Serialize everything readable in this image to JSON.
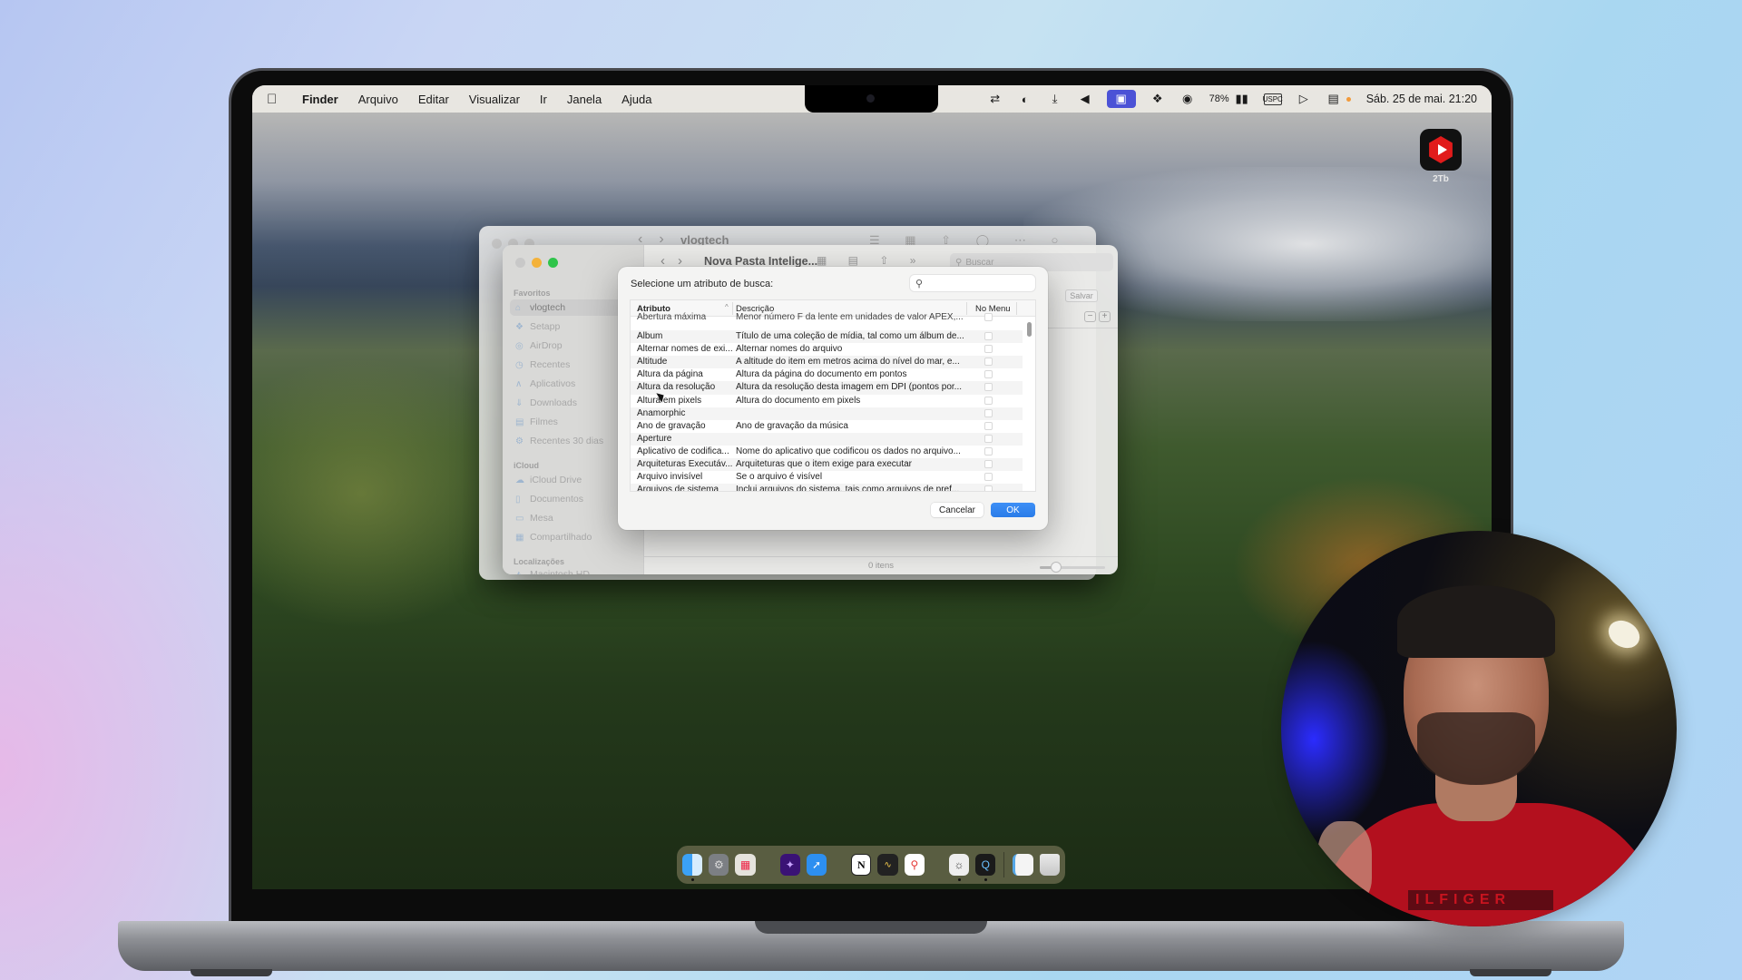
{
  "menubar": {
    "app_name": "Finder",
    "items": [
      "Arquivo",
      "Editar",
      "Visualizar",
      "Ir",
      "Janela",
      "Ajuda"
    ],
    "status_icons": [
      "screen-mirroring-icon",
      "contrast-icon",
      "download-icon",
      "nightshift-icon",
      "screen-sharing-icon",
      "setapp-icon",
      "camera-icon",
      "battery-icon",
      "keyboard-input-icon",
      "play-icon",
      "control-center-icon"
    ],
    "battery_percent": "78%",
    "input_source": "USPC",
    "datetime": "Sáb. 25 de mai.  21:20"
  },
  "desktop": {
    "widget_label": "2Tb"
  },
  "finder_back": {
    "title": "vlogtech"
  },
  "finder_front": {
    "title": "Nova Pasta Intelige...",
    "search_placeholder": "Buscar",
    "save_label": "Salvar",
    "status_text": "0 itens",
    "icon_size_slider": 0.25,
    "sidebar": {
      "sections": [
        {
          "title": "Favoritos",
          "items": [
            {
              "label": "vlogtech",
              "icon": "home-icon",
              "selected": true
            },
            {
              "label": "Setapp",
              "icon": "setapp-icon"
            },
            {
              "label": "AirDrop",
              "icon": "airdrop-icon"
            },
            {
              "label": "Recentes",
              "icon": "clock-icon"
            },
            {
              "label": "Aplicativos",
              "icon": "apps-icon"
            },
            {
              "label": "Downloads",
              "icon": "download-icon"
            },
            {
              "label": "Filmes",
              "icon": "film-icon"
            },
            {
              "label": "Recentes 30 dias",
              "icon": "gear-icon"
            }
          ]
        },
        {
          "title": "iCloud",
          "items": [
            {
              "label": "iCloud Drive",
              "icon": "cloud-icon"
            },
            {
              "label": "Documentos",
              "icon": "document-icon"
            },
            {
              "label": "Mesa",
              "icon": "desktop-icon"
            },
            {
              "label": "Compartilhado",
              "icon": "shared-folder-icon"
            }
          ]
        },
        {
          "title": "Localizações",
          "items": [
            {
              "label": "Macintosh HD",
              "icon": "disk-icon"
            }
          ]
        }
      ]
    }
  },
  "dialog": {
    "title": "Selecione um atributo de busca:",
    "search_value": "",
    "columns": [
      "Atributo",
      "Descrição",
      "No Menu"
    ],
    "rows": [
      {
        "attribute": "Abertura máxima",
        "description": "Menor número F da lente em unidades de valor APEX,...",
        "in_menu": false
      },
      {
        "attribute": "Álbum",
        "description": "Título de uma coleção de mídia, tal como um álbum de...",
        "in_menu": false
      },
      {
        "attribute": "Alternar nomes de exi...",
        "description": "Alternar nomes do arquivo",
        "in_menu": false
      },
      {
        "attribute": "Altitude",
        "description": "A altitude do item em metros acima do nível do mar, e...",
        "in_menu": false
      },
      {
        "attribute": "Altura da página",
        "description": "Altura da página do documento em pontos",
        "in_menu": false
      },
      {
        "attribute": "Altura da resolução",
        "description": "Altura da resolução desta imagem em DPI (pontos por...",
        "in_menu": false
      },
      {
        "attribute": "Altura em pixels",
        "description": "Altura do documento em pixels",
        "in_menu": false
      },
      {
        "attribute": "Anamorphic",
        "description": "",
        "in_menu": false
      },
      {
        "attribute": "Ano de gravação",
        "description": "Ano de gravação da música",
        "in_menu": false
      },
      {
        "attribute": "Aperture",
        "description": "",
        "in_menu": false
      },
      {
        "attribute": "Aplicativo de codifica...",
        "description": "Nome do aplicativo que codificou os dados no arquivo...",
        "in_menu": false
      },
      {
        "attribute": "Arquiteturas Executáv...",
        "description": "Arquiteturas que o item exige para executar",
        "in_menu": false
      },
      {
        "attribute": "Arquivo invisível",
        "description": "Se o arquivo é visível",
        "in_menu": false
      },
      {
        "attribute": "Arquivos de sistema",
        "description": "Inclui arquivos do sistema, tais como arquivos de pref...",
        "in_menu": false
      }
    ],
    "cancel_label": "Cancelar",
    "ok_label": "OK"
  },
  "dock": {
    "apps": [
      "Finder",
      "Ajustes do Sistema",
      "Launchpad",
      "Affinity",
      "Safari",
      "Notion",
      "Podcast App",
      "Google Maps",
      "Final Cut Pro",
      "QuickTime Player",
      "Preview",
      "Lixeira"
    ]
  },
  "webcam": {
    "shirt_text": "ILFIGER"
  }
}
